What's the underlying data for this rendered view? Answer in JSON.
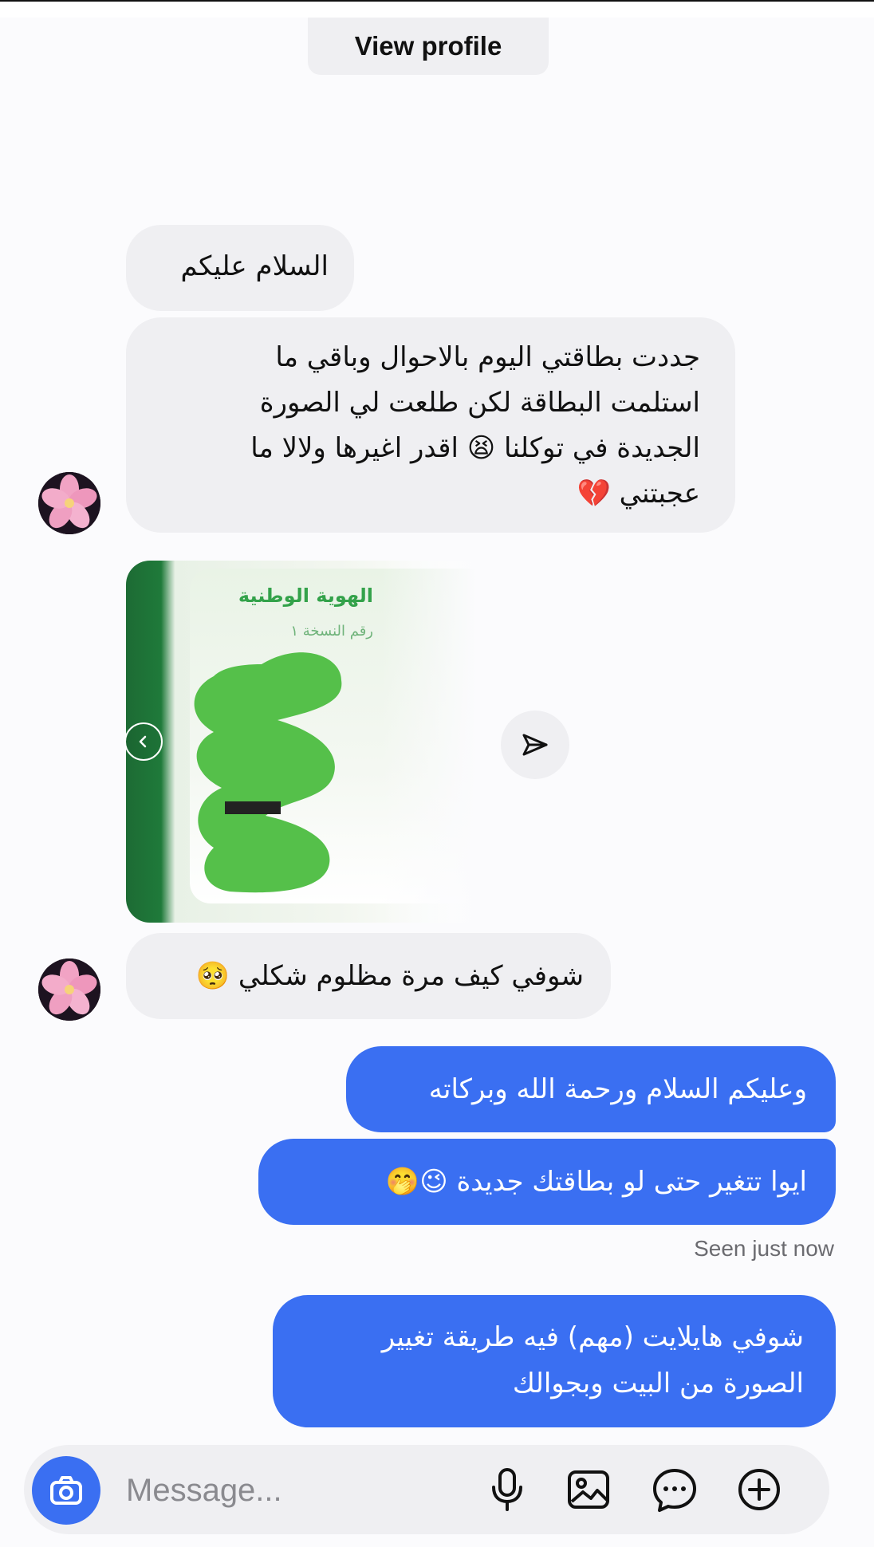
{
  "header": {
    "view_profile_label": "View profile"
  },
  "messages": [
    {
      "side": "in",
      "text": "السلام عليكم"
    },
    {
      "side": "in",
      "text": "جددت بطاقتي اليوم بالاحوال وباقي ما\nاستلمت البطاقة لكن طلعت لي الصورة\nالجديدة في توكلنا 😫 اقدر اغيرها ولالا ما\nعجبتني 💔"
    },
    {
      "side": "in",
      "type": "image",
      "card_title": "الهوية الوطنية",
      "card_subtitle": "رقم النسخة ١"
    },
    {
      "side": "in",
      "text": "شوفي كيف مرة مظلوم شكلي 🥺"
    },
    {
      "side": "out",
      "text": "وعليكم السلام ورحمة الله وبركاته"
    },
    {
      "side": "out",
      "text": "ايوا تتغير حتى لو بطاقتك جديدة 😉🤭"
    },
    {
      "side": "out",
      "text": "شوفي هايلايت (مهم) فيه طريقة تغيير\nالصورة من البيت وبجوالك"
    }
  ],
  "seen_status": "Seen just now",
  "composer": {
    "placeholder": "Message...",
    "icons": [
      "camera-icon",
      "microphone-icon",
      "gallery-icon",
      "sticker-icon",
      "add-icon"
    ]
  },
  "colors": {
    "outgoing_bubble": "#3a6ff2",
    "incoming_bubble": "#efeff2",
    "background": "#fbfbfd",
    "card_green": "#33a24a"
  }
}
